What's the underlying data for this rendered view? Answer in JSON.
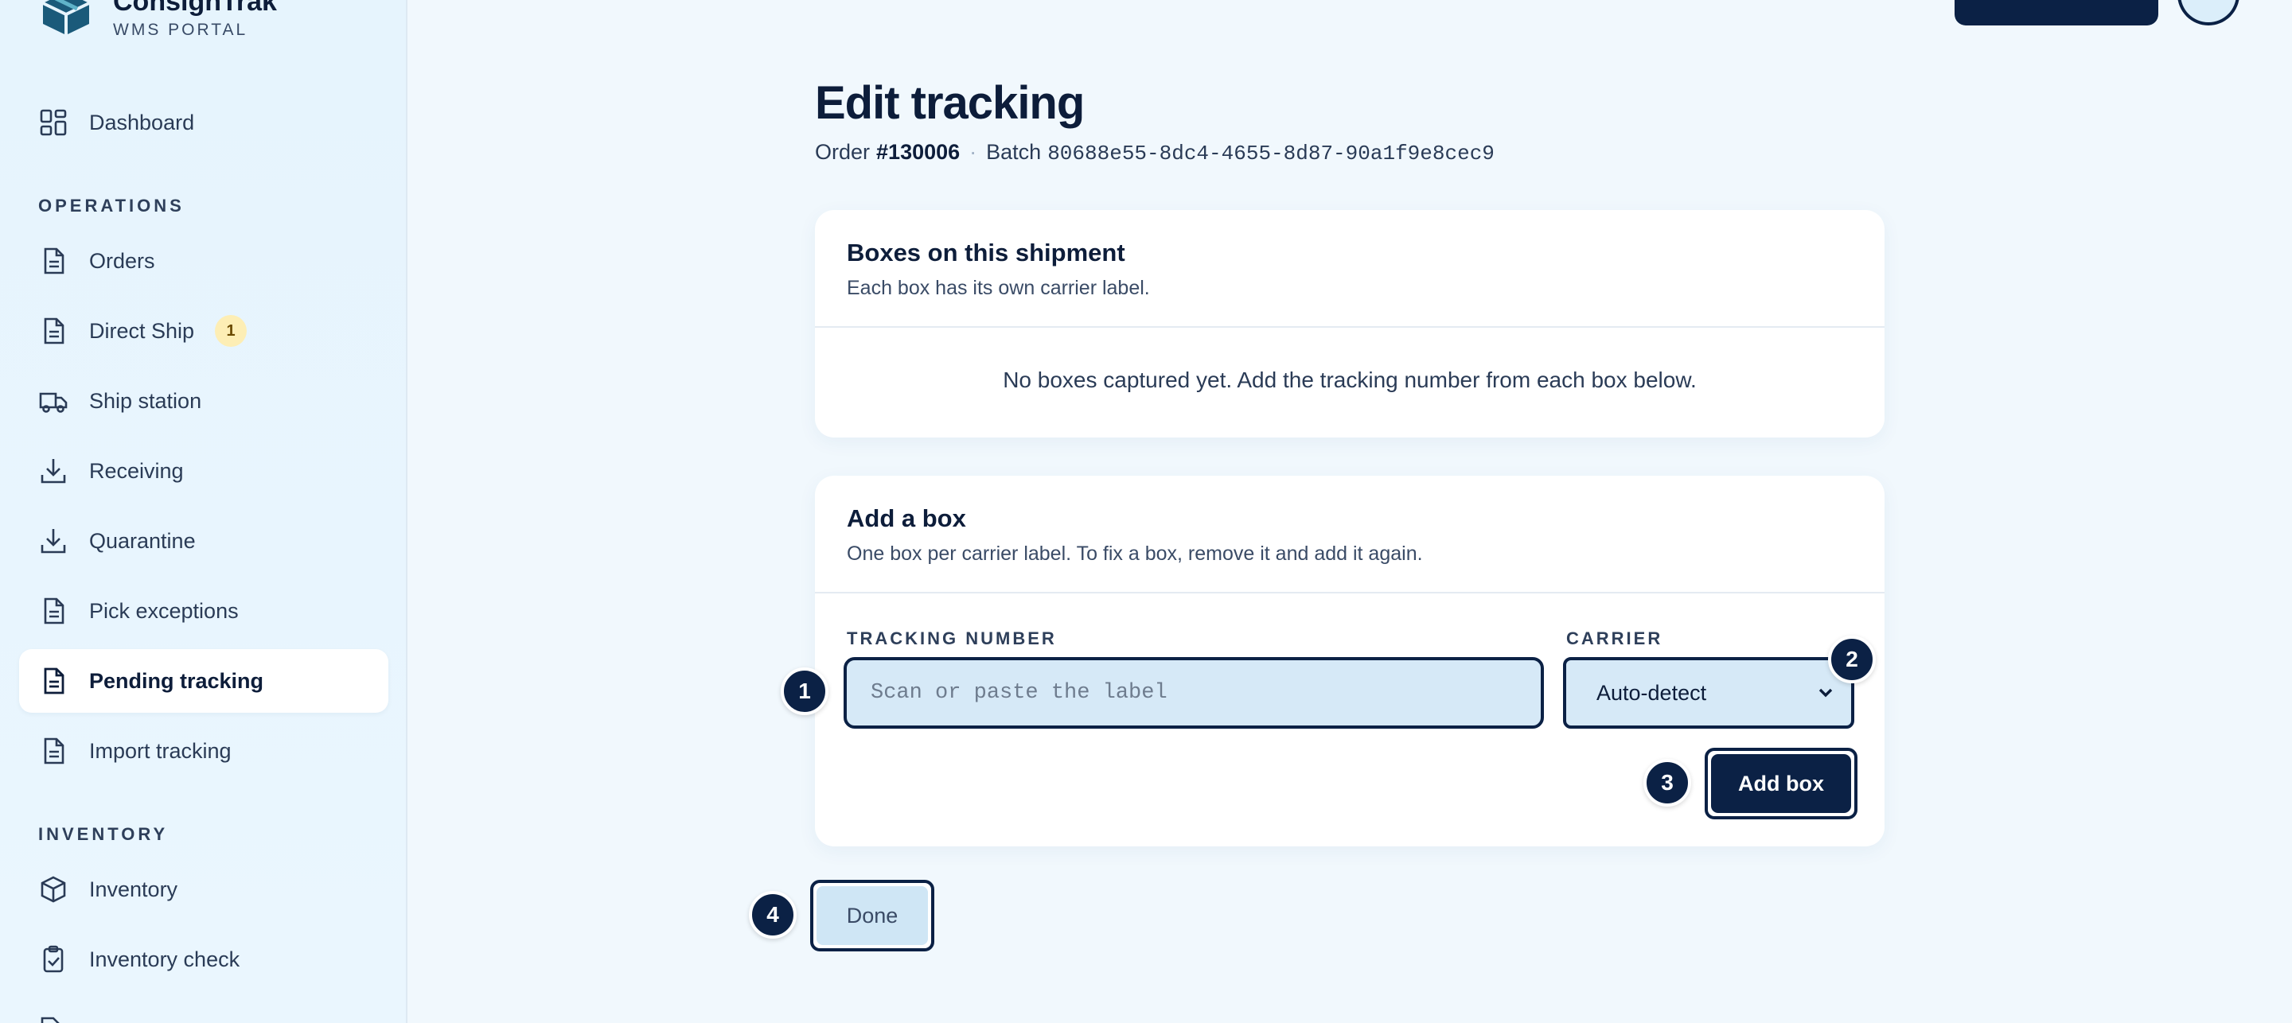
{
  "brand": {
    "name": "ConsignTrak",
    "subtitle": "WMS PORTAL"
  },
  "sidebar": {
    "dashboard": "Dashboard",
    "sections": {
      "operations": "OPERATIONS",
      "inventory": "INVENTORY"
    },
    "operations_items": [
      {
        "label": "Orders",
        "icon": "document-icon"
      },
      {
        "label": "Direct Ship",
        "icon": "document-icon",
        "badge": "1"
      },
      {
        "label": "Ship station",
        "icon": "truck-icon"
      },
      {
        "label": "Receiving",
        "icon": "download-icon"
      },
      {
        "label": "Quarantine",
        "icon": "download-icon"
      },
      {
        "label": "Pick exceptions",
        "icon": "document-icon"
      },
      {
        "label": "Pending tracking",
        "icon": "document-icon",
        "active": true
      },
      {
        "label": "Import tracking",
        "icon": "document-icon"
      }
    ],
    "inventory_items": [
      {
        "label": "Inventory",
        "icon": "box-icon"
      },
      {
        "label": "Inventory check",
        "icon": "clipboard-check-icon"
      }
    ]
  },
  "page": {
    "title": "Edit tracking",
    "order_label": "Order",
    "order_number": "#130006",
    "separator": "·",
    "batch_label": "Batch",
    "batch_id": "80688e55-8dc4-4655-8d87-90a1f9e8cec9"
  },
  "boxes_card": {
    "title": "Boxes on this shipment",
    "description": "Each box has its own carrier label.",
    "empty_message": "No boxes captured yet. Add the tracking number from each box below."
  },
  "add_card": {
    "title": "Add a box",
    "description": "One box per carrier label. To fix a box, remove it and add it again.",
    "tracking_label": "TRACKING NUMBER",
    "tracking_value": "",
    "tracking_placeholder": "Scan or paste the label",
    "carrier_label": "CARRIER",
    "carrier_selected": "Auto-detect",
    "add_button": "Add box"
  },
  "done_button": "Done",
  "markers": [
    "1",
    "2",
    "3",
    "4"
  ],
  "colors": {
    "accent": "#0b2145",
    "input_bg": "#d6e9f7",
    "badge_bg": "#fdeeb5"
  }
}
